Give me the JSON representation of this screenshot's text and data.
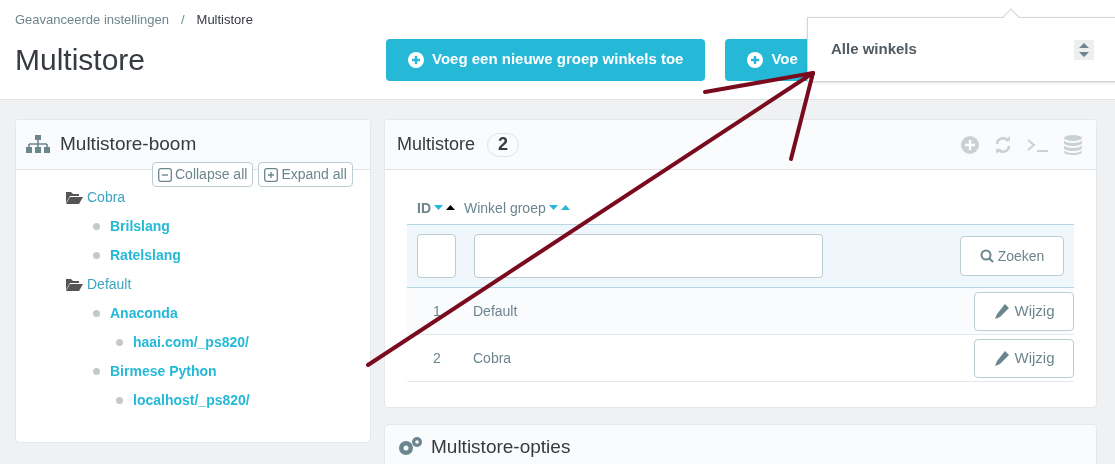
{
  "breadcrumb": [
    {
      "label": "Geavanceerde instellingen",
      "current": false
    },
    {
      "label": "Multistore",
      "current": true
    }
  ],
  "breadcrumb_separator": "/",
  "page_title": "Multistore",
  "toolbar_buttons": [
    {
      "label": "Voeg een nieuwe groep winkels toe"
    },
    {
      "label": "Voe"
    }
  ],
  "shop_selector": {
    "value": "Alle winkels"
  },
  "tree_panel": {
    "title": "Multistore-boom",
    "buttons": [
      {
        "kind": "collapse",
        "label": "Collapse all"
      },
      {
        "kind": "expand",
        "label": "Expand all"
      }
    ],
    "items": [
      {
        "label": "Cobra",
        "kind": "group",
        "children": [
          {
            "label": "Brilslang",
            "kind": "shop"
          },
          {
            "label": "Ratelslang",
            "kind": "shop"
          }
        ]
      },
      {
        "label": "Default",
        "kind": "group",
        "children": [
          {
            "label": "Anaconda",
            "kind": "shop",
            "children": [
              {
                "label": "haai.com/_ps820/",
                "kind": "url"
              }
            ]
          },
          {
            "label": "Birmese Python",
            "kind": "shop",
            "children": [
              {
                "label": "localhost/_ps820/",
                "kind": "url"
              }
            ]
          }
        ]
      }
    ]
  },
  "list_panel": {
    "title": "Multistore",
    "count": "2",
    "columns": [
      {
        "label": "ID",
        "sort_ascending_active": true
      },
      {
        "label": "Winkel groep",
        "sort_ascending_active": false
      }
    ],
    "search_button": "Zoeken",
    "rows": [
      {
        "id": "1",
        "name": "Default",
        "action": "Wijzig"
      },
      {
        "id": "2",
        "name": "Cobra",
        "action": "Wijzig"
      }
    ]
  },
  "options_panel": {
    "title": "Multistore-opties"
  }
}
